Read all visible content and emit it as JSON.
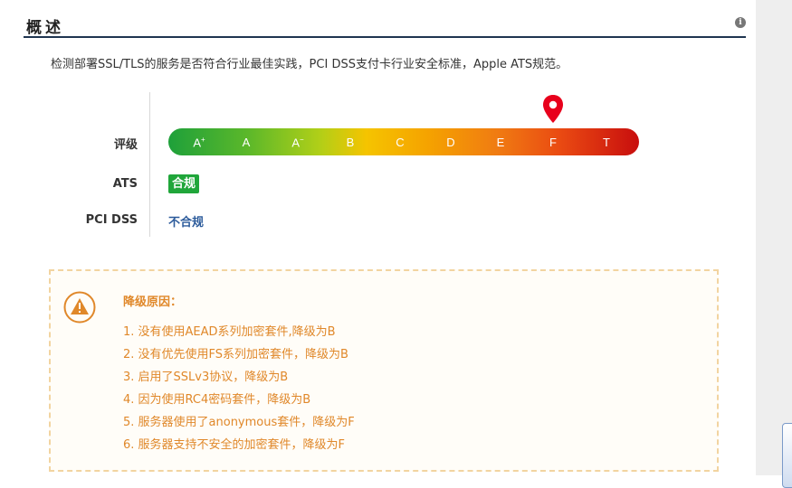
{
  "header": {
    "title": "概述",
    "info_icon": "info-icon"
  },
  "description": "检测部署SSL/TLS的服务是否符合行业最佳实践，PCI DSS支付卡行业安全标准，Apple ATS规范。",
  "rating": {
    "label": "评级",
    "grades": [
      {
        "base": "A",
        "sup": "+"
      },
      {
        "base": "A",
        "sup": ""
      },
      {
        "base": "A",
        "sup": "−"
      },
      {
        "base": "B",
        "sup": ""
      },
      {
        "base": "C",
        "sup": ""
      },
      {
        "base": "D",
        "sup": ""
      },
      {
        "base": "E",
        "sup": ""
      },
      {
        "base": "F",
        "sup": ""
      },
      {
        "base": "T",
        "sup": ""
      }
    ],
    "current": "F",
    "pin_icon": "map-pin-icon",
    "colors": {
      "start": "#1ea03a",
      "mid": "#f5c400",
      "end": "#c80e0e",
      "pin": "#e8001c"
    }
  },
  "ats": {
    "label": "ATS",
    "value": "合规",
    "color": "#20a63a"
  },
  "pci": {
    "label": "PCI DSS",
    "value": "不合规",
    "color": "#2c5b9b"
  },
  "downgrade": {
    "icon": "warning-icon",
    "title": "降级原因：",
    "color": "#e0882a",
    "reasons": [
      "1. 没有使用AEAD系列加密套件,降级为B",
      "2. 没有优先使用FS系列加密套件，降级为B",
      "3. 启用了SSLv3协议，降级为B",
      "4. 因为使用RC4密码套件，降级为B",
      "5. 服务器使用了anonymous套件，降级为F",
      "6. 服务器支持不安全的加密套件，降级为F"
    ]
  }
}
